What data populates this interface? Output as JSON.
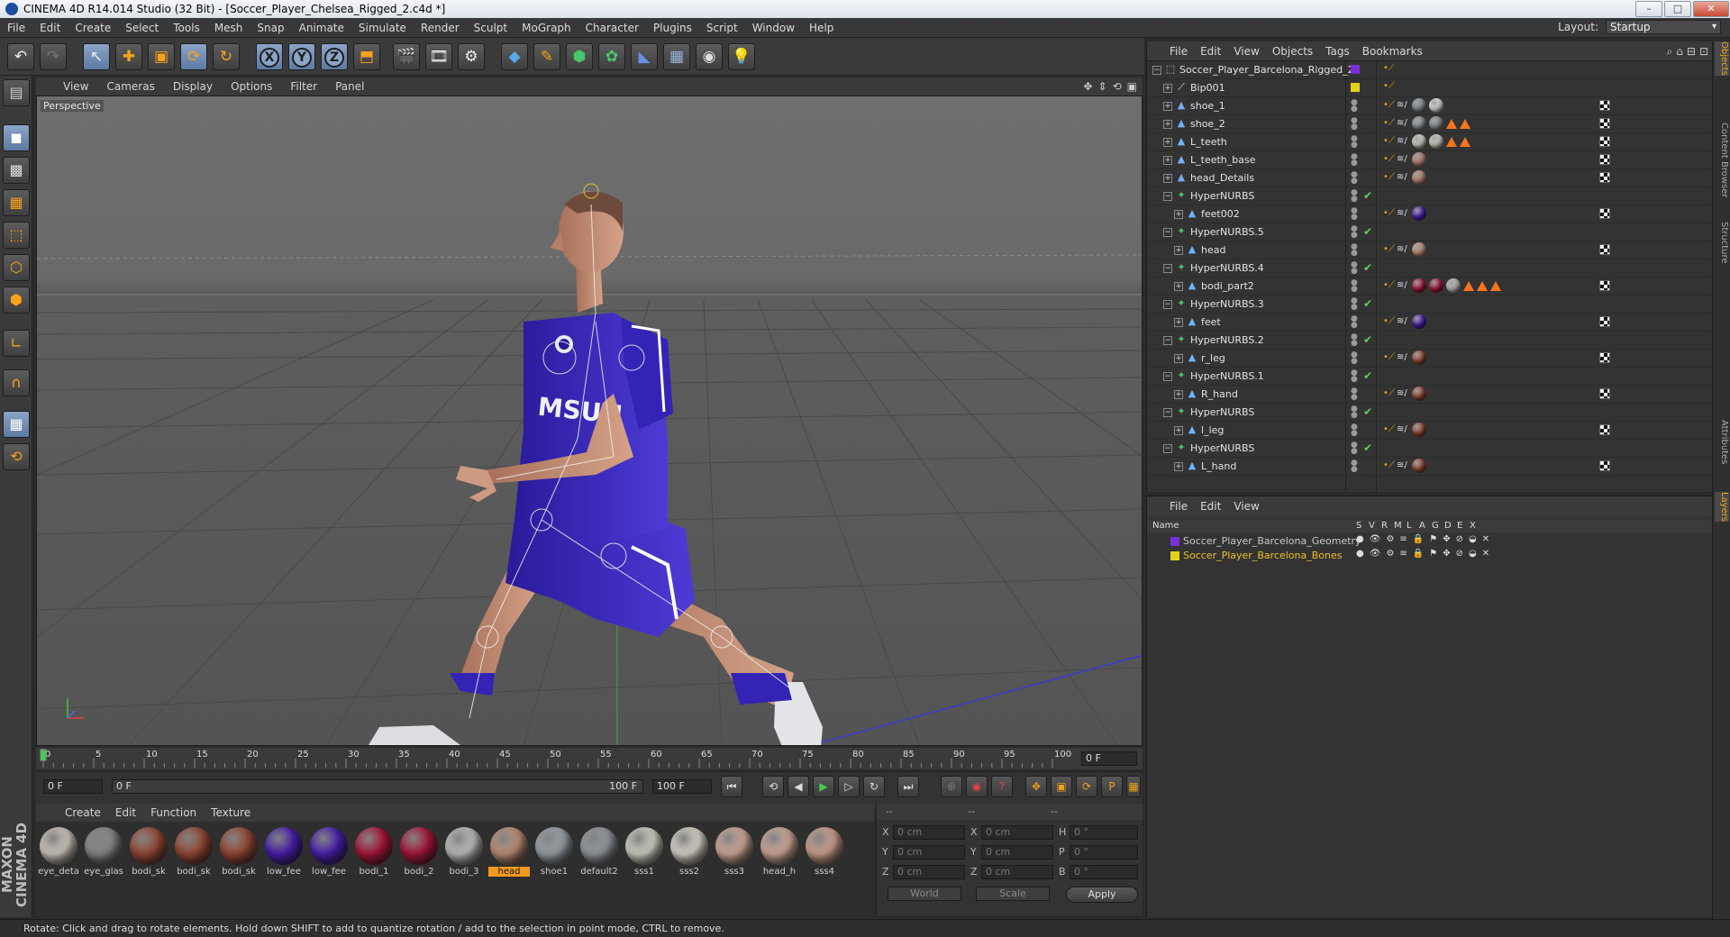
{
  "titlebar": {
    "title": "CINEMA 4D R14.014 Studio (32 Bit) - [Soccer_Player_Chelsea_Rigged_2.c4d *]",
    "min": "–",
    "max": "□",
    "close": "✕"
  },
  "menubar": [
    "File",
    "Edit",
    "Create",
    "Select",
    "Tools",
    "Mesh",
    "Snap",
    "Animate",
    "Simulate",
    "Render",
    "Sculpt",
    "MoGraph",
    "Character",
    "Plugins",
    "Script",
    "Window",
    "Help"
  ],
  "layout": {
    "label": "Layout:",
    "value": "Startup"
  },
  "viewport": {
    "menu": [
      "View",
      "Cameras",
      "Display",
      "Options",
      "Filter",
      "Panel"
    ],
    "label": "Perspective"
  },
  "timeline": {
    "ticks": [
      "0",
      "5",
      "10",
      "15",
      "20",
      "25",
      "30",
      "35",
      "40",
      "45",
      "50",
      "55",
      "60",
      "65",
      "70",
      "75",
      "80",
      "85",
      "90",
      "95",
      "100"
    ],
    "current_frame": "0 F",
    "start_field": "0 F",
    "range_start": "0 F",
    "range_end": "100 F",
    "end_field": "100 F"
  },
  "materials": {
    "menu": [
      "Create",
      "Edit",
      "Function",
      "Texture"
    ],
    "items": [
      {
        "label": "eye_deta",
        "color": "#d9d2c6"
      },
      {
        "label": "eye_glas",
        "color": "#8d8d8d"
      },
      {
        "label": "bodi_sk",
        "color": "#9c4b37"
      },
      {
        "label": "bodi_sk",
        "color": "#9c4b37"
      },
      {
        "label": "bodi_sk",
        "color": "#9c4b37"
      },
      {
        "label": "low_fee",
        "color": "#4b1fb5"
      },
      {
        "label": "low_fee",
        "color": "#4b1fb5"
      },
      {
        "label": "bodi_1",
        "color": "#b0163a"
      },
      {
        "label": "bodi_2",
        "color": "#b0163a"
      },
      {
        "label": "bodi_3",
        "color": "#c8c8c8"
      },
      {
        "label": "head",
        "color": "#c9967c",
        "selected": true
      },
      {
        "label": "shoe1",
        "color": "#a3a9b0"
      },
      {
        "label": "default2",
        "color": "#9a9fa5"
      },
      {
        "label": "sss1",
        "color": "#dcdcd0"
      },
      {
        "label": "sss2",
        "color": "#e5e0d5"
      },
      {
        "label": "sss3",
        "color": "#dcb2a0"
      },
      {
        "label": "head_h",
        "color": "#dcb2a0"
      },
      {
        "label": "sss4",
        "color": "#d9a994"
      }
    ]
  },
  "coords": {
    "header": [
      "--",
      "--",
      "--"
    ],
    "rows": [
      {
        "a": "X",
        "av": "0 cm",
        "b": "X",
        "bv": "0 cm",
        "c": "H",
        "cv": "0 °"
      },
      {
        "a": "Y",
        "av": "0 cm",
        "b": "Y",
        "bv": "0 cm",
        "c": "P",
        "cv": "0 °"
      },
      {
        "a": "Z",
        "av": "0 cm",
        "b": "Z",
        "bv": "0 cm",
        "c": "B",
        "cv": "0 °"
      }
    ],
    "mode1": "World",
    "mode2": "Scale",
    "apply": "Apply"
  },
  "status": "Rotate: Click and drag to rotate elements. Hold down SHIFT to add to quantize rotation / add to the selection in point mode, CTRL to remove.",
  "objects": {
    "menu": [
      "File",
      "Edit",
      "View",
      "Objects",
      "Tags",
      "Bookmarks"
    ],
    "rows": [
      {
        "name": "Soccer_Player_Barcelona_Rigged_2",
        "indent": 0,
        "icon": "L0",
        "tree": "−",
        "swatch": "#7b2fd6",
        "tags": [
          "ik"
        ]
      },
      {
        "name": "Bip001",
        "indent": 1,
        "icon": "bone",
        "tree": "+",
        "swatch": "#e4d11c",
        "tags": [
          "ik"
        ]
      },
      {
        "name": "shoe_1",
        "indent": 1,
        "icon": "poly",
        "tree": "+",
        "tags": [
          "ik",
          "ph",
          "#8d959c",
          "#f0f0f0",
          "check"
        ]
      },
      {
        "name": "shoe_2",
        "indent": 1,
        "icon": "poly",
        "tree": "+",
        "tags": [
          "ik",
          "ph",
          "#8d959c",
          "#8d959c",
          "tri",
          "tri",
          "check"
        ]
      },
      {
        "name": "L_teeth",
        "indent": 1,
        "icon": "poly",
        "tree": "+",
        "tags": [
          "ik",
          "ph",
          "#e0e0d4",
          "#e0e0d4",
          "tri",
          "tri",
          "check"
        ]
      },
      {
        "name": "L_teeth_base",
        "indent": 1,
        "icon": "poly",
        "tree": "+",
        "tags": [
          "ik",
          "ph",
          "#c08a78",
          "check"
        ]
      },
      {
        "name": "head_Details",
        "indent": 1,
        "icon": "poly",
        "tree": "+",
        "tags": [
          "ik",
          "ph",
          "#c08a78",
          "check"
        ]
      },
      {
        "name": "HyperNURBS",
        "indent": 1,
        "icon": "nurbs",
        "tree": "−",
        "check": true,
        "tags": []
      },
      {
        "name": "feet002",
        "indent": 2,
        "icon": "poly",
        "tree": "+",
        "tags": [
          "ik",
          "ph",
          "#4b1fb5",
          "check"
        ]
      },
      {
        "name": "HyperNURBS.5",
        "indent": 1,
        "icon": "nurbs",
        "tree": "−",
        "check": true,
        "tags": []
      },
      {
        "name": "head",
        "indent": 2,
        "icon": "poly",
        "tree": "+",
        "tags": [
          "ik",
          "ph",
          "#c9967c",
          "check"
        ]
      },
      {
        "name": "HyperNURBS.4",
        "indent": 1,
        "icon": "nurbs",
        "tree": "−",
        "check": true,
        "tags": []
      },
      {
        "name": "bodi_part2",
        "indent": 2,
        "icon": "poly",
        "tree": "+",
        "tags": [
          "ik",
          "ph",
          "#b0163a",
          "#b0163a",
          "#c8c8c8",
          "tri",
          "tri",
          "tri",
          "check"
        ]
      },
      {
        "name": "HyperNURBS.3",
        "indent": 1,
        "icon": "nurbs",
        "tree": "−",
        "check": true,
        "tags": []
      },
      {
        "name": "feet",
        "indent": 2,
        "icon": "poly",
        "tree": "+",
        "tags": [
          "ik",
          "ph",
          "#4b1fb5",
          "check"
        ]
      },
      {
        "name": "HyperNURBS.2",
        "indent": 1,
        "icon": "nurbs",
        "tree": "−",
        "check": true,
        "tags": []
      },
      {
        "name": "r_leg",
        "indent": 2,
        "icon": "poly",
        "tree": "+",
        "tags": [
          "ik",
          "ph",
          "#9c4b37",
          "check"
        ]
      },
      {
        "name": "HyperNURBS.1",
        "indent": 1,
        "icon": "nurbs",
        "tree": "−",
        "check": true,
        "tags": []
      },
      {
        "name": "R_hand",
        "indent": 2,
        "icon": "poly",
        "tree": "+",
        "tags": [
          "ik",
          "ph",
          "#9c4b37",
          "check"
        ]
      },
      {
        "name": "HyperNURBS",
        "indent": 1,
        "icon": "nurbs",
        "tree": "−",
        "check": true,
        "tags": []
      },
      {
        "name": "l_leg",
        "indent": 2,
        "icon": "poly",
        "tree": "+",
        "tags": [
          "ik",
          "ph",
          "#9c4b37",
          "check"
        ]
      },
      {
        "name": "HyperNURBS",
        "indent": 1,
        "icon": "nurbs",
        "tree": "−",
        "check": true,
        "tags": []
      },
      {
        "name": "L_hand",
        "indent": 2,
        "icon": "poly",
        "tree": "+",
        "tags": [
          "ik",
          "ph",
          "#9c4b37",
          "check"
        ]
      }
    ]
  },
  "layers": {
    "menu": [
      "File",
      "Edit",
      "View"
    ],
    "columns": [
      "Name",
      "S",
      "V",
      "R",
      "M",
      "L",
      "A",
      "G",
      "D",
      "E",
      "X"
    ],
    "rows": [
      {
        "name": "Soccer_Player_Barcelona_Geometry",
        "color": "#7b2fd6",
        "text": "#c9c9c9"
      },
      {
        "name": "Soccer_Player_Barcelona_Bones",
        "color": "#e4d11c",
        "text": "#f0c020"
      }
    ]
  },
  "dock_tabs": [
    "Objects",
    "Content Browser",
    "Structure",
    "Attributes",
    "Layers"
  ],
  "brand": {
    "line1": "MAXON",
    "line2": "CINEMA 4D"
  }
}
